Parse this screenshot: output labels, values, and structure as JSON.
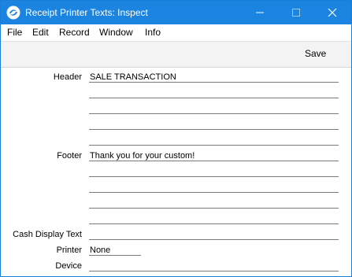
{
  "window": {
    "title": "Receipt Printer Texts: Inspect"
  },
  "menu": {
    "items": [
      "File",
      "Edit",
      "Record",
      "Window",
      "Info"
    ]
  },
  "toolbar": {
    "save_label": "Save"
  },
  "form": {
    "header_label": "Header",
    "header_lines": [
      "SALE TRANSACTION",
      "",
      "",
      "",
      ""
    ],
    "footer_label": "Footer",
    "footer_lines": [
      "Thank you for your custom!",
      "",
      "",
      "",
      ""
    ],
    "cash_display_label": "Cash Display Text",
    "cash_display_value": "",
    "printer_label": "Printer",
    "printer_value": "None",
    "device_label": "Device",
    "device_value": ""
  },
  "icons": {
    "app": "hansaworld-swirl-icon",
    "minimize": "minimize-icon",
    "maximize": "maximize-icon",
    "close": "close-icon"
  },
  "colors": {
    "titlebar": "#1a84e0",
    "toolbar": "#f3f3f3"
  }
}
